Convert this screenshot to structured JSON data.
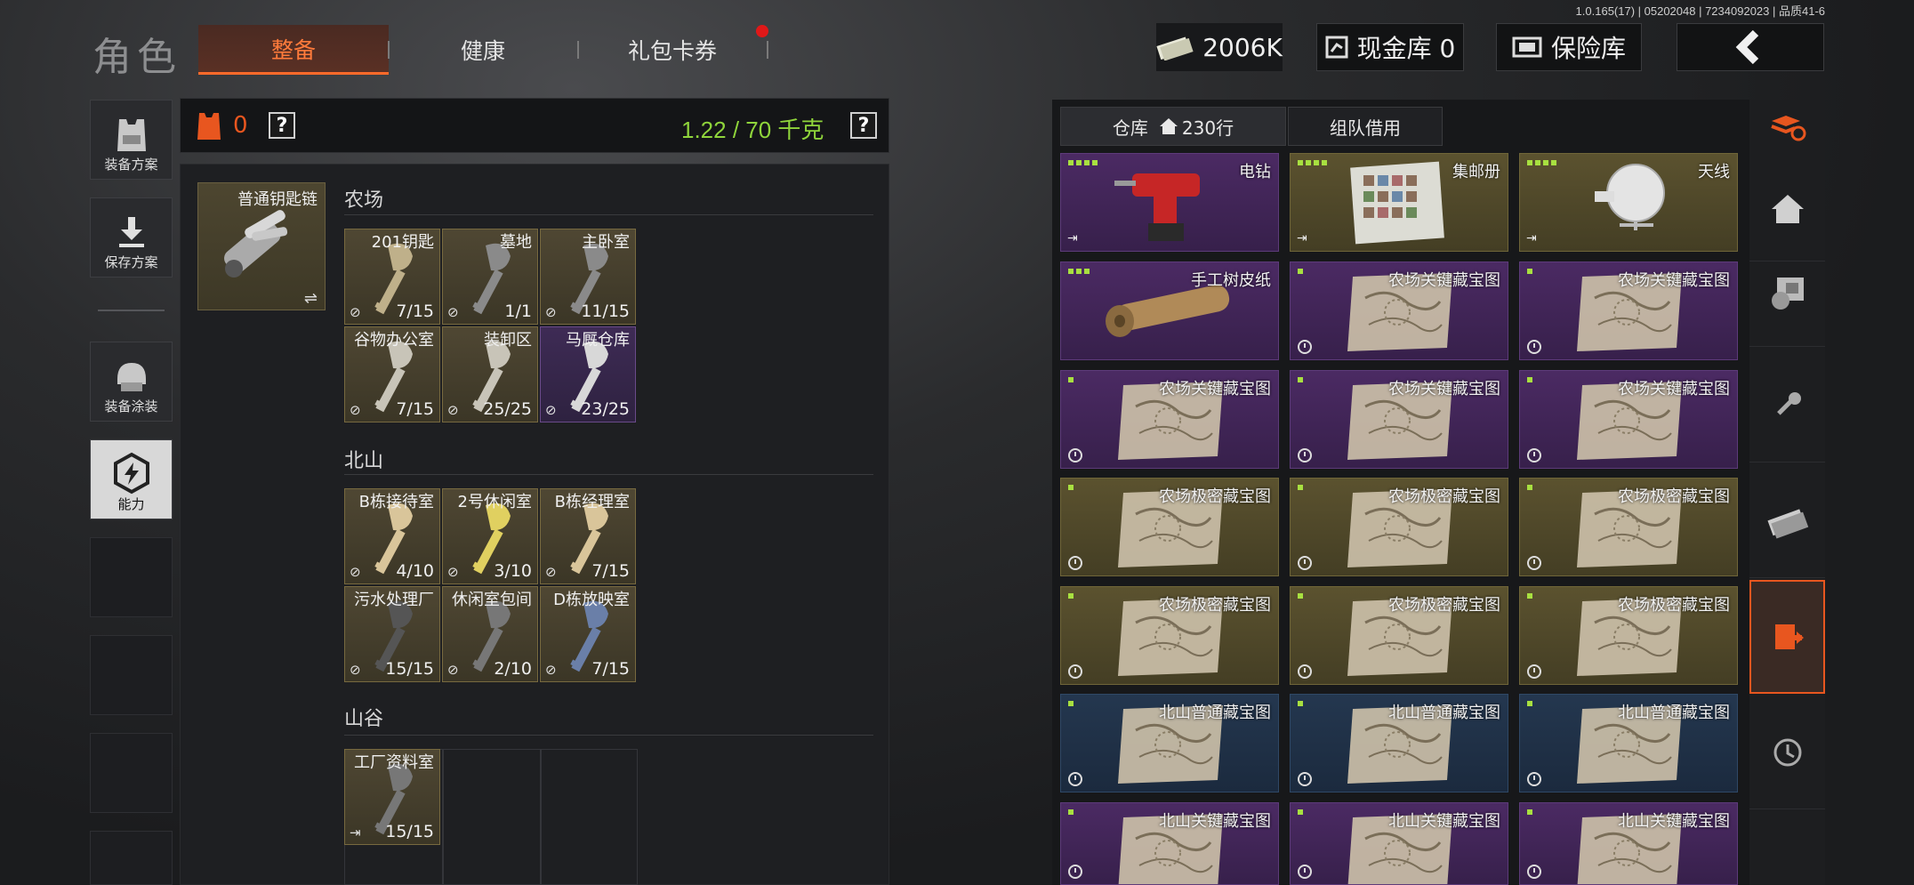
{
  "version": "1.0.165(17) | 05202048 | 7234092023 | 品质41-6",
  "header": {
    "title": "角色",
    "tabs": [
      {
        "label": "整备",
        "active": true
      },
      {
        "label": "健康",
        "active": false
      },
      {
        "label": "礼包卡券",
        "active": false
      }
    ],
    "money": "2006K",
    "cash_vault": "现金库 0",
    "safe_box": "保险库"
  },
  "left_rail": [
    {
      "label": "装备方案",
      "icon": "armor-vest-icon"
    },
    {
      "label": "保存方案",
      "icon": "download-icon"
    },
    {
      "label": "装备涂装",
      "icon": "helmet-icon"
    },
    {
      "label": "能力",
      "icon": "ability-bolt-icon",
      "selected": true
    }
  ],
  "loadout": {
    "armor_count": "0",
    "weight": "1.22 / 70 千克",
    "help": "?"
  },
  "keychain": {
    "label": "普通钥匙链",
    "swap_icon": "⇌"
  },
  "sections": [
    {
      "title": "农场",
      "keys": [
        {
          "name": "201钥匙",
          "count": "7/15",
          "color": "gold",
          "key_color": "#bfb08a"
        },
        {
          "name": "墓地",
          "count": "1/1",
          "color": "gold",
          "key_color": "#8a8a8a"
        },
        {
          "name": "主卧室",
          "count": "11/15",
          "color": "gold",
          "key_color": "#8a8a8a"
        },
        {
          "name": "谷物办公室",
          "count": "7/15",
          "color": "gold",
          "key_color": "#c8c4b8"
        },
        {
          "name": "装卸区",
          "count": "25/25",
          "color": "gold",
          "key_color": "#c8c4b8"
        },
        {
          "name": "马厩仓库",
          "count": "23/25",
          "color": "purple",
          "key_color": "#d8d8d8"
        }
      ]
    },
    {
      "title": "北山",
      "keys": [
        {
          "name": "B栋接待室",
          "count": "4/10",
          "color": "gold",
          "key_color": "#d9c59a"
        },
        {
          "name": "2号休闲室",
          "count": "3/10",
          "color": "gold",
          "key_color": "#e0d060"
        },
        {
          "name": "B栋经理室",
          "count": "7/15",
          "color": "gold",
          "key_color": "#d9c59a"
        },
        {
          "name": "污水处理厂",
          "count": "15/15",
          "color": "gold",
          "key_color": "#555"
        },
        {
          "name": "休闲室包间",
          "count": "2/10",
          "color": "gold",
          "key_color": "#777"
        },
        {
          "name": "D栋放映室",
          "count": "7/15",
          "color": "gold",
          "key_color": "#6a7fa8"
        }
      ]
    },
    {
      "title": "山谷",
      "keys": [
        {
          "name": "工厂资料室",
          "count": "15/15",
          "color": "gold",
          "key_color": "#777"
        }
      ]
    }
  ],
  "warehouse": {
    "tabs": [
      {
        "label": "仓库",
        "extra": "230行",
        "active": true
      },
      {
        "label": "组队借用",
        "active": false
      }
    ],
    "items": [
      {
        "name": "电钻",
        "color": "purple",
        "dots": 4,
        "icon": "drill"
      },
      {
        "name": "集邮册",
        "color": "gold",
        "dots": 4,
        "icon": "album"
      },
      {
        "name": "天线",
        "color": "gold",
        "dots": 4,
        "icon": "antenna"
      },
      {
        "name": "手工树皮纸",
        "color": "purple",
        "dots": 3,
        "icon": "scroll"
      },
      {
        "name": "农场关键藏宝图",
        "color": "purple",
        "dots": 1,
        "icon": "map"
      },
      {
        "name": "农场关键藏宝图",
        "color": "purple",
        "dots": 1,
        "icon": "map"
      },
      {
        "name": "农场关键藏宝图",
        "color": "purple",
        "dots": 1,
        "icon": "map"
      },
      {
        "name": "农场关键藏宝图",
        "color": "purple",
        "dots": 1,
        "icon": "map"
      },
      {
        "name": "农场关键藏宝图",
        "color": "purple",
        "dots": 1,
        "icon": "map"
      },
      {
        "name": "农场极密藏宝图",
        "color": "gold",
        "dots": 1,
        "icon": "map"
      },
      {
        "name": "农场极密藏宝图",
        "color": "gold",
        "dots": 1,
        "icon": "map"
      },
      {
        "name": "农场极密藏宝图",
        "color": "gold",
        "dots": 1,
        "icon": "map"
      },
      {
        "name": "农场极密藏宝图",
        "color": "gold",
        "dots": 1,
        "icon": "map"
      },
      {
        "name": "农场极密藏宝图",
        "color": "gold",
        "dots": 1,
        "icon": "map"
      },
      {
        "name": "农场极密藏宝图",
        "color": "gold",
        "dots": 1,
        "icon": "map"
      },
      {
        "name": "北山普通藏宝图",
        "color": "blue",
        "dots": 1,
        "icon": "map"
      },
      {
        "name": "北山普通藏宝图",
        "color": "blue",
        "dots": 1,
        "icon": "map"
      },
      {
        "name": "北山普通藏宝图",
        "color": "blue",
        "dots": 1,
        "icon": "map"
      },
      {
        "name": "北山关键藏宝图",
        "color": "purple",
        "dots": 1,
        "icon": "map"
      },
      {
        "name": "北山关键藏宝图",
        "color": "purple",
        "dots": 1,
        "icon": "map"
      },
      {
        "name": "北山关键藏宝图",
        "color": "purple",
        "dots": 1,
        "icon": "map"
      }
    ]
  },
  "right_rail": [
    {
      "icon": "stack-refresh-icon"
    },
    {
      "icon": "home-icon"
    },
    {
      "icon": "coins-icon"
    },
    {
      "icon": "key-icon"
    },
    {
      "icon": "cash-icon"
    },
    {
      "icon": "import-icon",
      "active": true
    },
    {
      "icon": "clock-icon"
    }
  ]
}
